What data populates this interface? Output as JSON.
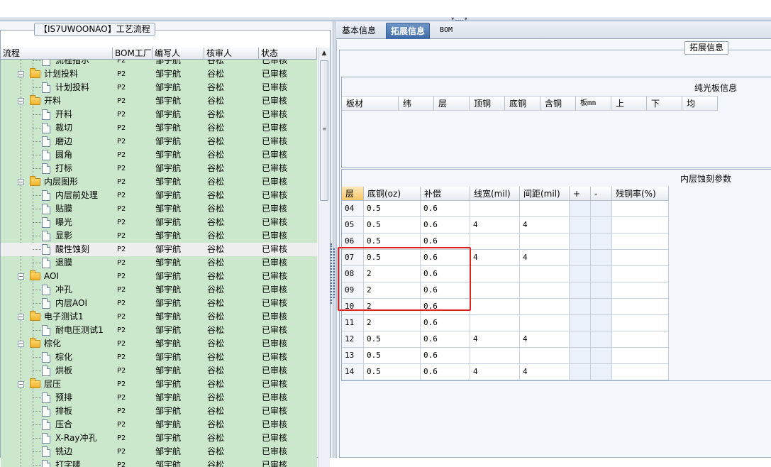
{
  "left_panel": {
    "group_title": "【IS7UWOONAO】工艺流程",
    "columns": [
      "流程",
      "BOM工厂",
      "编写人",
      "核审人",
      "状态"
    ],
    "rows": [
      {
        "name": "流程指示",
        "level": 2,
        "kind": "doc",
        "bom": "P2",
        "writer": "邹宇航",
        "checker": "谷松",
        "status": "已审核"
      },
      {
        "name": "计划投料",
        "level": 1,
        "kind": "folder",
        "bom": "P2",
        "writer": "邹宇航",
        "checker": "谷松",
        "status": "已审核"
      },
      {
        "name": "计划投料",
        "level": 2,
        "kind": "doc",
        "bom": "P2",
        "writer": "邹宇航",
        "checker": "谷松",
        "status": "已审核"
      },
      {
        "name": "开料",
        "level": 1,
        "kind": "folder",
        "bom": "P2",
        "writer": "邹宇航",
        "checker": "谷松",
        "status": "已审核"
      },
      {
        "name": "开料",
        "level": 2,
        "kind": "doc",
        "bom": "P2",
        "writer": "邹宇航",
        "checker": "谷松",
        "status": "已审核"
      },
      {
        "name": "裁切",
        "level": 2,
        "kind": "doc",
        "bom": "P2",
        "writer": "邹宇航",
        "checker": "谷松",
        "status": "已审核"
      },
      {
        "name": "磨边",
        "level": 2,
        "kind": "doc",
        "bom": "P2",
        "writer": "邹宇航",
        "checker": "谷松",
        "status": "已审核"
      },
      {
        "name": "圆角",
        "level": 2,
        "kind": "doc",
        "bom": "P2",
        "writer": "邹宇航",
        "checker": "谷松",
        "status": "已审核"
      },
      {
        "name": "打标",
        "level": 2,
        "kind": "doc",
        "bom": "P2",
        "writer": "邹宇航",
        "checker": "谷松",
        "status": "已审核"
      },
      {
        "name": "内层图形",
        "level": 1,
        "kind": "folder",
        "bom": "P2",
        "writer": "邹宇航",
        "checker": "谷松",
        "status": "已审核"
      },
      {
        "name": "内层前处理",
        "level": 2,
        "kind": "doc",
        "bom": "P2",
        "writer": "邹宇航",
        "checker": "谷松",
        "status": "已审核"
      },
      {
        "name": "贴膜",
        "level": 2,
        "kind": "doc",
        "bom": "P2",
        "writer": "邹宇航",
        "checker": "谷松",
        "status": "已审核"
      },
      {
        "name": "曝光",
        "level": 2,
        "kind": "doc",
        "bom": "P2",
        "writer": "邹宇航",
        "checker": "谷松",
        "status": "已审核"
      },
      {
        "name": "显影",
        "level": 2,
        "kind": "doc",
        "bom": "P2",
        "writer": "邹宇航",
        "checker": "谷松",
        "status": "已审核"
      },
      {
        "name": "酸性蚀刻",
        "level": 2,
        "kind": "doc",
        "bom": "P2",
        "writer": "邹宇航",
        "checker": "谷松",
        "status": "已审核",
        "selected": true
      },
      {
        "name": "退膜",
        "level": 2,
        "kind": "doc",
        "bom": "P2",
        "writer": "邹宇航",
        "checker": "谷松",
        "status": "已审核"
      },
      {
        "name": "AOI",
        "level": 1,
        "kind": "folder",
        "bom": "P2",
        "writer": "邹宇航",
        "checker": "谷松",
        "status": "已审核"
      },
      {
        "name": "冲孔",
        "level": 2,
        "kind": "doc",
        "bom": "P2",
        "writer": "邹宇航",
        "checker": "谷松",
        "status": "已审核"
      },
      {
        "name": "内层AOI",
        "level": 2,
        "kind": "doc",
        "bom": "P2",
        "writer": "邹宇航",
        "checker": "谷松",
        "status": "已审核"
      },
      {
        "name": "电子测试1",
        "level": 1,
        "kind": "folder",
        "bom": "P2",
        "writer": "邹宇航",
        "checker": "谷松",
        "status": "已审核"
      },
      {
        "name": "耐电压测试1",
        "level": 2,
        "kind": "doc",
        "bom": "P2",
        "writer": "邹宇航",
        "checker": "谷松",
        "status": "已审核"
      },
      {
        "name": "棕化",
        "level": 1,
        "kind": "folder",
        "bom": "P2",
        "writer": "邹宇航",
        "checker": "谷松",
        "status": "已审核"
      },
      {
        "name": "棕化",
        "level": 2,
        "kind": "doc",
        "bom": "P2",
        "writer": "邹宇航",
        "checker": "谷松",
        "status": "已审核"
      },
      {
        "name": "烘板",
        "level": 2,
        "kind": "doc",
        "bom": "P2",
        "writer": "邹宇航",
        "checker": "谷松",
        "status": "已审核"
      },
      {
        "name": "层压",
        "level": 1,
        "kind": "folder",
        "bom": "P2",
        "writer": "邹宇航",
        "checker": "谷松",
        "status": "已审核"
      },
      {
        "name": "预排",
        "level": 2,
        "kind": "doc",
        "bom": "P2",
        "writer": "邹宇航",
        "checker": "谷松",
        "status": "已审核"
      },
      {
        "name": "排板",
        "level": 2,
        "kind": "doc",
        "bom": "P2",
        "writer": "邹宇航",
        "checker": "谷松",
        "status": "已审核"
      },
      {
        "name": "压合",
        "level": 2,
        "kind": "doc",
        "bom": "P2",
        "writer": "邹宇航",
        "checker": "谷松",
        "status": "已审核"
      },
      {
        "name": "X-Ray冲孔",
        "level": 2,
        "kind": "doc",
        "bom": "P2",
        "writer": "邹宇航",
        "checker": "谷松",
        "status": "已审核"
      },
      {
        "name": "铣边",
        "level": 2,
        "kind": "doc",
        "bom": "P2",
        "writer": "邹宇航",
        "checker": "谷松",
        "status": "已审核"
      },
      {
        "name": "打字唛",
        "level": 2,
        "kind": "doc",
        "bom": "P2",
        "writer": "邹宇航",
        "checker": "谷松",
        "status": "已审核"
      }
    ]
  },
  "right_panel": {
    "tabs": [
      {
        "label": "基本信息",
        "active": false
      },
      {
        "label": "拓展信息",
        "active": true
      },
      {
        "label": "BOM",
        "active": false
      }
    ],
    "group_title": "拓展信息",
    "pure_board": {
      "title": "纯光板信息",
      "columns": [
        "板材",
        "纬",
        "层",
        "顶铜",
        "底铜",
        "含铜",
        "板mm",
        "上",
        "下",
        "均"
      ]
    },
    "inner_etch": {
      "title": "内层蚀刻参数",
      "columns": [
        "层",
        "底铜(oz)",
        "补偿",
        "线宽(mil)",
        "间距(mil)",
        "+",
        "-",
        "残铜率(%)"
      ],
      "rows": [
        {
          "layer": "04",
          "base": "0.5",
          "comp": "0.6",
          "width": "",
          "gap": ""
        },
        {
          "layer": "05",
          "base": "0.5",
          "comp": "0.6",
          "width": "4",
          "gap": "4"
        },
        {
          "layer": "06",
          "base": "0.5",
          "comp": "0.6",
          "width": "",
          "gap": ""
        },
        {
          "layer": "07",
          "base": "0.5",
          "comp": "0.6",
          "width": "4",
          "gap": "4"
        },
        {
          "layer": "08",
          "base": "2",
          "comp": "0.6",
          "width": "",
          "gap": ""
        },
        {
          "layer": "09",
          "base": "2",
          "comp": "0.6",
          "width": "",
          "gap": ""
        },
        {
          "layer": "10",
          "base": "2",
          "comp": "0.6",
          "width": "",
          "gap": ""
        },
        {
          "layer": "11",
          "base": "2",
          "comp": "0.6",
          "width": "",
          "gap": ""
        },
        {
          "layer": "12",
          "base": "0.5",
          "comp": "0.6",
          "width": "4",
          "gap": "4"
        },
        {
          "layer": "13",
          "base": "0.5",
          "comp": "0.6",
          "width": "",
          "gap": ""
        },
        {
          "layer": "14",
          "base": "0.5",
          "comp": "0.6",
          "width": "4",
          "gap": "4"
        }
      ]
    },
    "highlight_color": "#e02424"
  }
}
